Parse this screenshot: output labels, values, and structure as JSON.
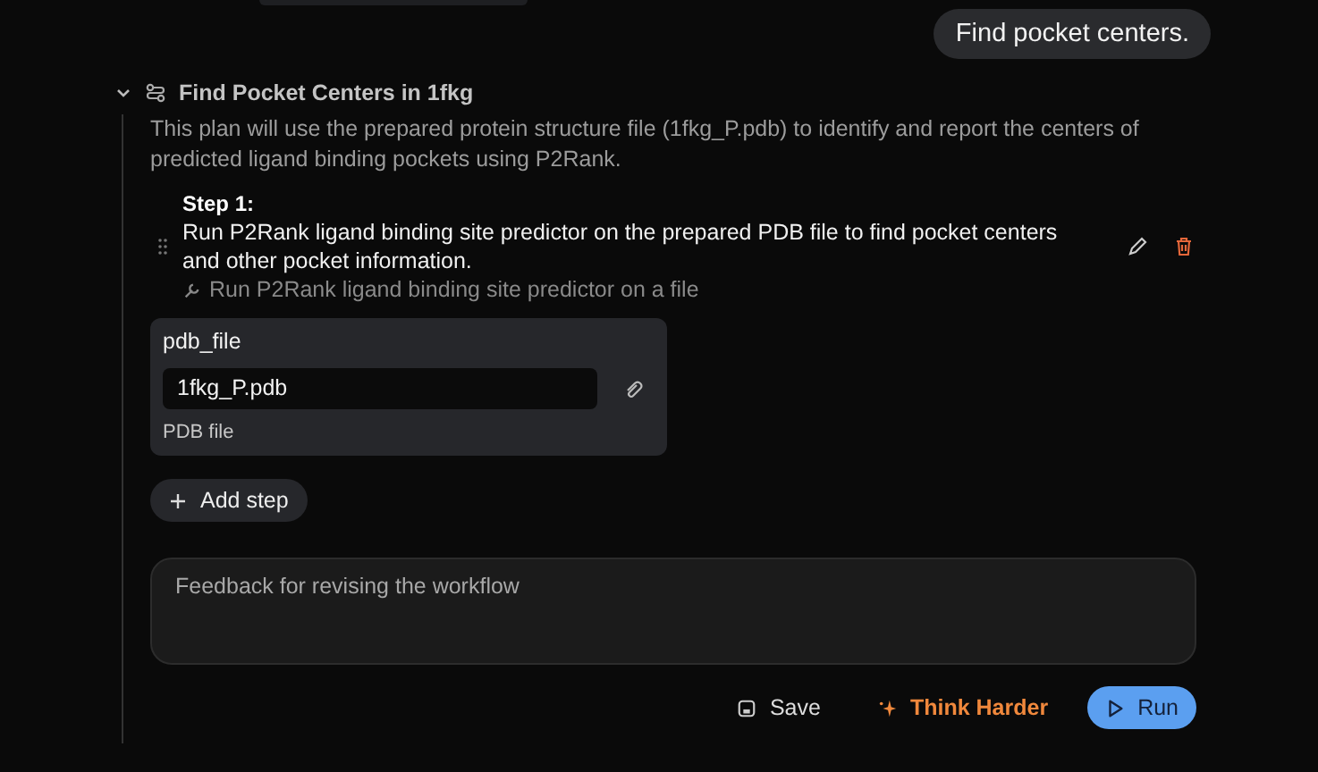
{
  "user_message": "Find pocket centers.",
  "plan": {
    "expanded": true,
    "title": "Find Pocket Centers in 1fkg",
    "description": "This plan will use the prepared protein structure file (1fkg_P.pdb) to identify and report the centers of predicted ligand binding pockets using P2Rank.",
    "steps": [
      {
        "label": "Step 1:",
        "description": "Run P2Rank ligand binding site predictor on the prepared PDB file to find pocket centers and other pocket information.",
        "tool": "Run P2Rank ligand binding site predictor on a file",
        "params": [
          {
            "name": "pdb_file",
            "value": "1fkg_P.pdb",
            "hint": "PDB file"
          }
        ]
      }
    ],
    "add_step": "Add step",
    "feedback": {
      "placeholder": "Feedback for revising the workflow"
    },
    "actions": [
      {
        "kind": "save",
        "label": "Save"
      },
      {
        "kind": "think",
        "label": "Think Harder"
      },
      {
        "kind": "run",
        "label": "Run"
      }
    ]
  }
}
